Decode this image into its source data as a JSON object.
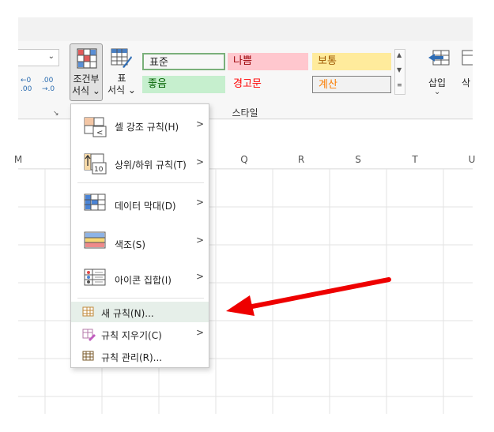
{
  "ribbon": {
    "dec_increase": "←0 .00",
    "dec_decrease": ".00 →.0",
    "cond_format_line1": "조건부",
    "cond_format_line2": "서식",
    "format_table_line1": "표",
    "format_table_line2": "서식",
    "styles_group_label": "스타일",
    "insert_label": "삽입",
    "delete_label": "삭",
    "cell_styles": [
      {
        "label": "표준",
        "bg": "#ffffff",
        "color": "#000000"
      },
      {
        "label": "나쁨",
        "bg": "#ffc7ce",
        "color": "#9c0006"
      },
      {
        "label": "보통",
        "bg": "#ffeb9c",
        "color": "#9c5700"
      },
      {
        "label": "좋음",
        "bg": "#c6efce",
        "color": "#006100"
      },
      {
        "label": "경고문",
        "bg": "#ffffff",
        "color": "#ff0000"
      },
      {
        "label": "계산",
        "bg": "#f2f2f2",
        "color": "#fa7d00"
      }
    ]
  },
  "sheet": {
    "columns": [
      "M",
      "Q",
      "R",
      "S",
      "T",
      "U"
    ]
  },
  "menu": {
    "items": [
      {
        "label": "셀 강조 규칙(H)",
        "icon": "highlight-rules-icon"
      },
      {
        "label": "상위/하위 규칙(T)",
        "icon": "top-bottom-rules-icon"
      },
      {
        "label": "데이터 막대(D)",
        "icon": "data-bars-icon"
      },
      {
        "label": "색조(S)",
        "icon": "color-scales-icon"
      },
      {
        "label": "아이콘 집합(I)",
        "icon": "icon-sets-icon"
      }
    ],
    "new_rule": "새 규칙(N)...",
    "clear_rules": "규칙 지우기(C)",
    "manage_rules": "규칙 관리(R)..."
  },
  "colors": {
    "annotation_arrow": "#ee0000",
    "ribbon_bg": "#f7f7f7",
    "hover_bg": "#e6efe9"
  }
}
